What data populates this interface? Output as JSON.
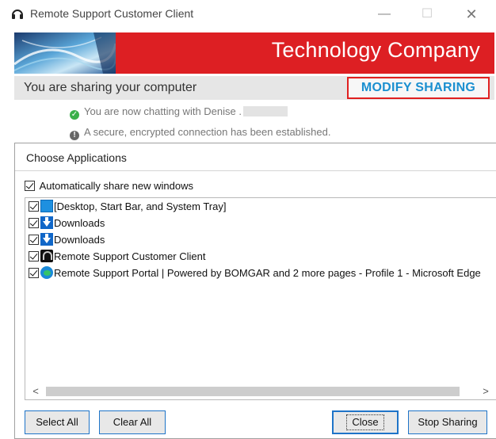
{
  "window": {
    "title": "Remote Support Customer Client",
    "minimize_glyph": "—",
    "maximize_glyph": "☐",
    "close_glyph": "✕"
  },
  "banner": {
    "company": "Technology Company",
    "brand_color": "#dd1f23"
  },
  "sharing_bar": {
    "message": "You are sharing your computer",
    "modify_label": "MODIFY SHARING",
    "modify_color": "#1a8fd0",
    "highlight_color": "#e02020"
  },
  "status": {
    "chat": "You are now chatting with Denise .",
    "secure": "A secure, encrypted connection has been established.",
    "chat_icon": "check-circle-icon",
    "secure_icon": "info-circle-icon"
  },
  "dialog": {
    "title": "Choose Applications",
    "auto_share_label": "Automatically share new windows",
    "applications": [
      {
        "label": "[Desktop, Start Bar, and System Tray]",
        "icon": "desktop-icon",
        "checked": true
      },
      {
        "label": "Downloads",
        "icon": "downloads-folder-icon",
        "checked": true
      },
      {
        "label": "Downloads",
        "icon": "downloads-folder-icon",
        "checked": true
      },
      {
        "label": "Remote Support Customer Client",
        "icon": "remote-support-icon",
        "checked": true
      },
      {
        "label": "Remote Support Portal | Powered by BOMGAR and 2 more pages - Profile 1 - Microsoft Edge",
        "icon": "edge-icon",
        "checked": true
      }
    ],
    "scroll_left": "<",
    "scroll_right": ">",
    "buttons": {
      "select_all": "Select All",
      "clear_all": "Clear All",
      "close": "Close",
      "stop_sharing": "Stop Sharing"
    }
  }
}
